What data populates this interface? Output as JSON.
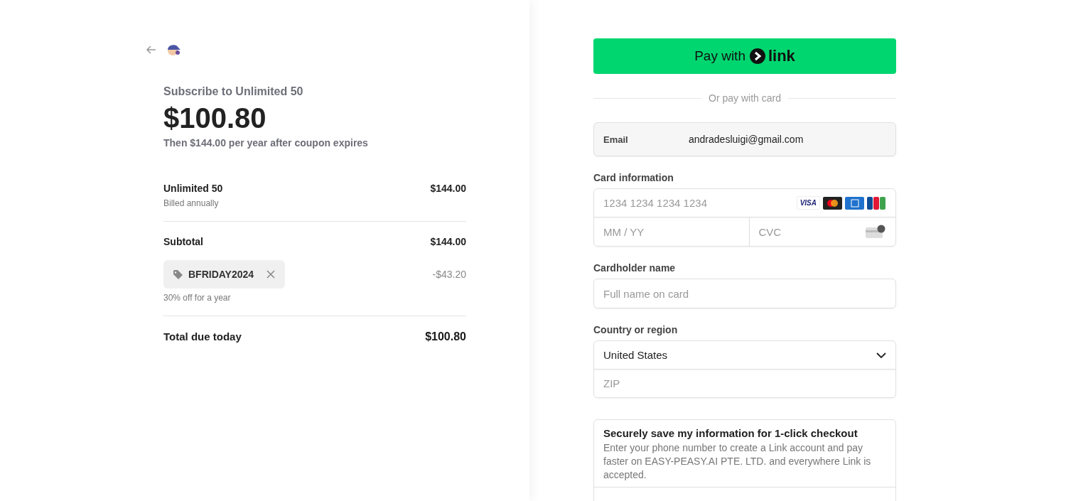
{
  "summary": {
    "title": "Subscribe to Unlimited 50",
    "price": "$100.80",
    "note": "Then $144.00 per year after coupon expires",
    "line_item": {
      "name": "Unlimited 50",
      "sub": "Billed annually",
      "amount": "$144.00"
    },
    "subtotal": {
      "label": "Subtotal",
      "amount": "$144.00"
    },
    "coupon": {
      "code": "BFRIDAY2024",
      "amount": "-$43.20",
      "description": "30% off for a year"
    },
    "total": {
      "label": "Total due today",
      "amount": "$100.80"
    }
  },
  "payment": {
    "link_button": {
      "text": "Pay with",
      "brand": "link"
    },
    "divider": "Or pay with card",
    "email": {
      "label": "Email",
      "value": "andradesluigi@gmail.com"
    },
    "card": {
      "label": "Card information",
      "number_placeholder": "1234 1234 1234 1234",
      "expiry_placeholder": "MM / YY",
      "cvc_placeholder": "CVC",
      "visa_text": "VISA"
    },
    "cardholder": {
      "label": "Cardholder name",
      "placeholder": "Full name on card"
    },
    "country": {
      "label": "Country or region",
      "value": "United States",
      "zip_placeholder": "ZIP"
    },
    "save_info": {
      "title": "Securely save my information for 1-click checkout",
      "text": "Enter your phone number to create a Link account and pay faster on EASY-PEASY.AI PTE. LTD. and everywhere Link is accepted."
    }
  }
}
